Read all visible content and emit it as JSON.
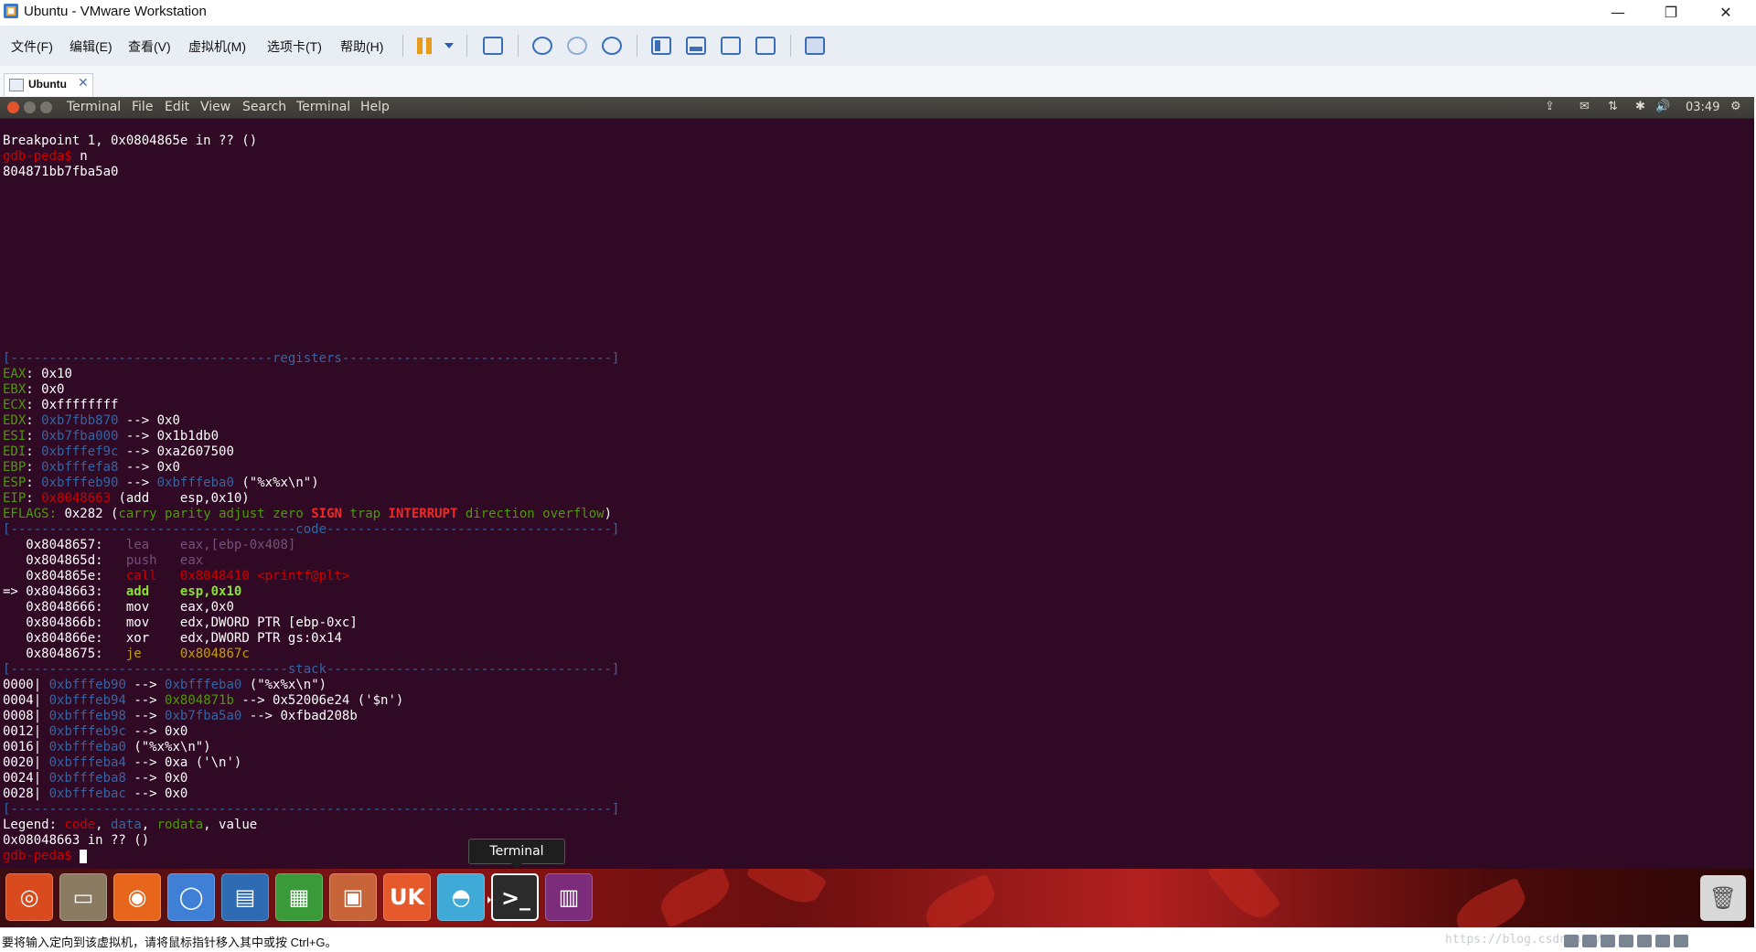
{
  "window": {
    "title": "Ubuntu - VMware Workstation",
    "controls": {
      "minimize": "—",
      "restore": "❐",
      "close": "✕"
    }
  },
  "menu": {
    "items": [
      "文件(F)",
      "编辑(E)",
      "查看(V)",
      "虚拟机(M)",
      "选项卡(T)",
      "帮助(H)"
    ]
  },
  "toolbar": {
    "icons": [
      "pause-icon",
      "send-ctrl-alt-del-icon",
      "snapshot-take-icon",
      "snapshot-revert-icon",
      "snapshot-manager-icon",
      "sidebar-toggle-icon",
      "thumbnail-bar-icon",
      "fullscreen-icon",
      "unity-icon",
      "console-view-icon"
    ]
  },
  "tab": {
    "label": "Ubuntu",
    "close": "✕"
  },
  "guest": {
    "menu": [
      "Terminal",
      "File",
      "Edit",
      "View",
      "Search",
      "Terminal",
      "Help"
    ],
    "indicators": [
      "⇪",
      "✉",
      "⇅",
      "✱",
      "🔊"
    ],
    "clock": "03:49",
    "gear": "⚙"
  },
  "terminal": {
    "prompt": "gdb-peda$",
    "header": {
      "breakpoint": "Breakpoint 1, 0x0804865e in ?? ()",
      "command": " n",
      "output": "804871bb7fba5a0"
    },
    "registers_banner": "[----------------------------------registers-----------------------------------]",
    "registers": [
      {
        "name": "EAX",
        "val": "0x10",
        "rest": ""
      },
      {
        "name": "EBX",
        "val": "0x0",
        "rest": ""
      },
      {
        "name": "ECX",
        "val": "0xffffffff",
        "rest": ""
      },
      {
        "name": "EDX",
        "val": "0xb7fbb870",
        "rest": " --> 0x0"
      },
      {
        "name": "ESI",
        "val": "0xb7fba000",
        "rest": " --> 0x1b1db0"
      },
      {
        "name": "EDI",
        "val": "0xbfffef9c",
        "rest": " --> 0xa2607500"
      },
      {
        "name": "EBP",
        "val": "0xbfffefa8",
        "rest": " --> 0x0"
      },
      {
        "name": "ESP",
        "val": "0xbfffeb90",
        "rest": " --> ",
        "ptr": "0xbfffeba0",
        "str": " (\"%x%x\\n\")"
      },
      {
        "name": "EIP",
        "val": "0x8048663",
        "rest": " (add    esp,0x10)"
      }
    ],
    "eflags": {
      "label": "EFLAGS:",
      "value": " 0x282 (",
      "flags": [
        {
          "t": "carry",
          "on": false
        },
        {
          "t": "parity",
          "on": false
        },
        {
          "t": "adjust",
          "on": false
        },
        {
          "t": "zero",
          "on": false
        },
        {
          "t": "SIGN",
          "on": true
        },
        {
          "t": "trap",
          "on": false
        },
        {
          "t": "INTERRUPT",
          "on": true
        },
        {
          "t": "direction",
          "on": false
        },
        {
          "t": "overflow",
          "on": false
        }
      ],
      "close": ")"
    },
    "code_banner": "[-------------------------------------code-------------------------------------]",
    "code": [
      {
        "arrow": "   ",
        "addr": "0x8048657:",
        "op": "lea",
        "args": "eax,[ebp-0x408]",
        "style": "dim"
      },
      {
        "arrow": "   ",
        "addr": "0x804865d:",
        "op": "push",
        "args": "eax",
        "style": "dim"
      },
      {
        "arrow": "   ",
        "addr": "0x804865e:",
        "op": "call",
        "args": "0x8048410 <printf@plt>",
        "style": "call"
      },
      {
        "arrow": "=> ",
        "addr": "0x8048663:",
        "op": "add",
        "args": "esp,0x10",
        "style": "current"
      },
      {
        "arrow": "   ",
        "addr": "0x8048666:",
        "op": "mov",
        "args": "eax,0x0",
        "style": "plain"
      },
      {
        "arrow": "   ",
        "addr": "0x804866b:",
        "op": "mov",
        "args": "edx,DWORD PTR [ebp-0xc]",
        "style": "plain"
      },
      {
        "arrow": "   ",
        "addr": "0x804866e:",
        "op": "xor",
        "args": "edx,DWORD PTR gs:0x14",
        "style": "plain"
      },
      {
        "arrow": "   ",
        "addr": "0x8048675:",
        "op": "je",
        "args": "0x804867c",
        "style": "jump"
      }
    ],
    "stack_banner": "[------------------------------------stack-------------------------------------]",
    "stack": [
      {
        "off": "0000|",
        "addr": "0xbfffeb90",
        "chain": [
          " --> ",
          {
            "c": "blue",
            "t": "0xbfffeba0"
          },
          " (\"%x%x\\n\")"
        ]
      },
      {
        "off": "0004|",
        "addr": "0xbfffeb94",
        "chain": [
          " --> ",
          {
            "c": "green",
            "t": "0x804871b"
          },
          " --> 0x52006e24 ('$n')"
        ]
      },
      {
        "off": "0008|",
        "addr": "0xbfffeb98",
        "chain": [
          " --> ",
          {
            "c": "blue",
            "t": "0xb7fba5a0"
          },
          " --> 0xfbad208b"
        ]
      },
      {
        "off": "0012|",
        "addr": "0xbfffeb9c",
        "chain": [
          " --> 0x0"
        ]
      },
      {
        "off": "0016|",
        "addr": "0xbfffeba0",
        "chain": [
          " (\"%x%x\\n\")"
        ]
      },
      {
        "off": "0020|",
        "addr": "0xbfffeba4",
        "chain": [
          " --> 0xa ('\\n')"
        ]
      },
      {
        "off": "0024|",
        "addr": "0xbfffeba8",
        "chain": [
          " --> 0x0"
        ]
      },
      {
        "off": "0028|",
        "addr": "0xbfffebac",
        "chain": [
          " --> 0x0"
        ]
      }
    ],
    "end_banner": "[------------------------------------------------------------------------------]",
    "legend": {
      "label": "Legend: ",
      "code": "code",
      "data": "data",
      "rodata": "rodata",
      "value": "value"
    },
    "footer": "0x08048663 in ?? ()"
  },
  "tooltip": "Terminal",
  "launcher": {
    "items": [
      {
        "name": "ubuntu-dash-icon",
        "glyph": "◎",
        "bg": "#d94a1e"
      },
      {
        "name": "files-icon",
        "glyph": "▭",
        "bg": "#8c7b63"
      },
      {
        "name": "firefox-icon",
        "glyph": "◉",
        "bg": "#e8661c"
      },
      {
        "name": "chromium-icon",
        "glyph": "◯",
        "bg": "#3f7fd6"
      },
      {
        "name": "writer-icon",
        "glyph": "▤",
        "bg": "#2e6bb2"
      },
      {
        "name": "calc-icon",
        "glyph": "▦",
        "bg": "#3a9a3a"
      },
      {
        "name": "impress-icon",
        "glyph": "▣",
        "bg": "#c8643a"
      },
      {
        "name": "software-center-icon",
        "glyph": "UK",
        "bg": "#e6592a"
      },
      {
        "name": "amazon-icon",
        "glyph": "◓",
        "bg": "#3fa9d8"
      },
      {
        "name": "terminal-icon",
        "glyph": ">_",
        "bg": "#2b2b2b",
        "active": true
      },
      {
        "name": "workspace-switcher-icon",
        "glyph": "▥",
        "bg": "#7b2c7b"
      }
    ],
    "trash": "🗑"
  },
  "status": {
    "text": "要将输入定向到该虚拟机，请将鼠标指针移入其中或按 Ctrl+G。",
    "watermark": "https://blog.csdn.net/..."
  }
}
